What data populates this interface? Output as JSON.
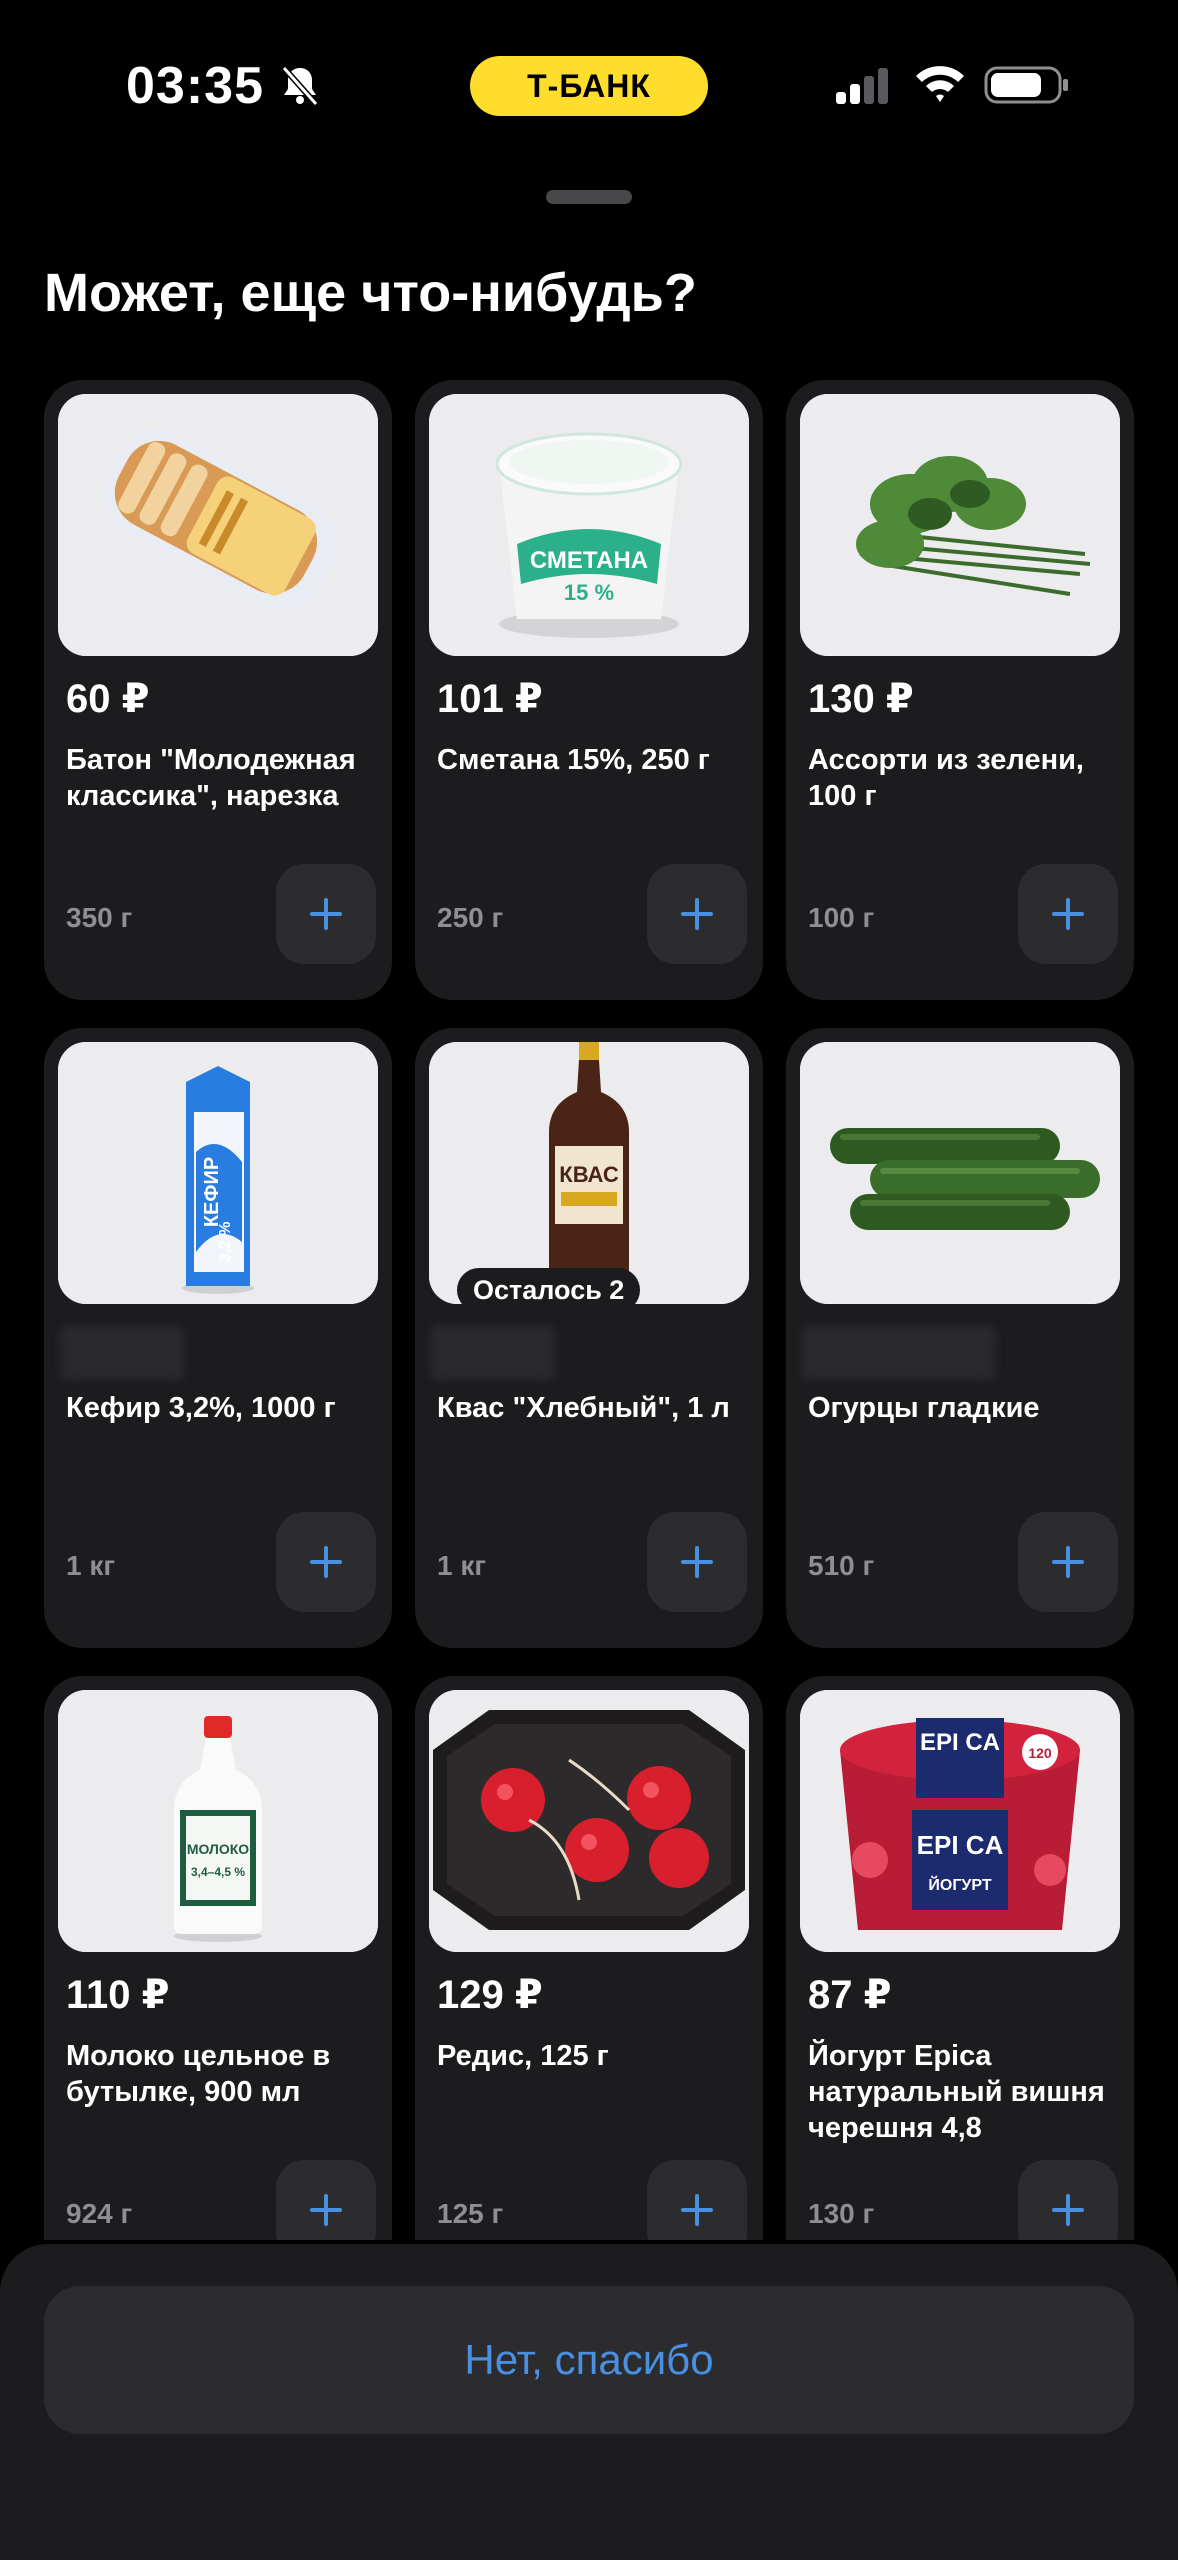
{
  "status": {
    "time": "03:35",
    "bank": "Т-БАНК"
  },
  "title": "Может, еще что-нибудь?",
  "products": [
    {
      "price": "60 ₽",
      "name": "Батон \"Молодежная классика\", нарезка",
      "weight": "350 г"
    },
    {
      "price": "101 ₽",
      "name": "Сметана 15%, 250 г",
      "weight": "250 г"
    },
    {
      "price": "130 ₽",
      "name": "Ассорти из зелени, 100 г",
      "weight": "100 г"
    },
    {
      "price": "",
      "name": "Кефир 3,2%, 1000 г",
      "weight": "1 кг"
    },
    {
      "price": "",
      "name": "Квас \"Хлебный\", 1 л",
      "weight": "1 кг",
      "badge": "Осталось 2"
    },
    {
      "price": "",
      "name": "Огурцы гладкие",
      "weight": "510 г"
    },
    {
      "price": "110 ₽",
      "name": "Молоко цельное в бутылке, 900 мл",
      "weight": "924 г"
    },
    {
      "price": "129 ₽",
      "name": "Редис, 125 г",
      "weight": "125 г"
    },
    {
      "price": "87 ₽",
      "name": "Йогурт Epica натуральный вишня черешня 4,8",
      "weight": "130 г"
    }
  ],
  "image_text": {
    "smetana_label": "СМЕТАНА",
    "smetana_pct": "15 %",
    "kefir_label": "КЕФИР",
    "kefir_pct": "3,2 %",
    "kvas_label": "КВАС",
    "moloko_label": "МОЛОКО",
    "moloko_pct": "3,4–4,5 %",
    "epica_brand": "EPI CA",
    "epica_sub": "ЙОГУРТ",
    "epica_weight": "120"
  },
  "footer": {
    "no_thanks": "Нет, спасибо"
  },
  "colors": {
    "accent": "#4a90e2",
    "brand_yellow": "#FFDD2D",
    "card_bg": "#1c1c1e",
    "button_bg": "#2c2c2e"
  },
  "icons": [
    "bell-off-icon",
    "signal-icon",
    "wifi-icon",
    "battery-icon",
    "plus-icon"
  ]
}
